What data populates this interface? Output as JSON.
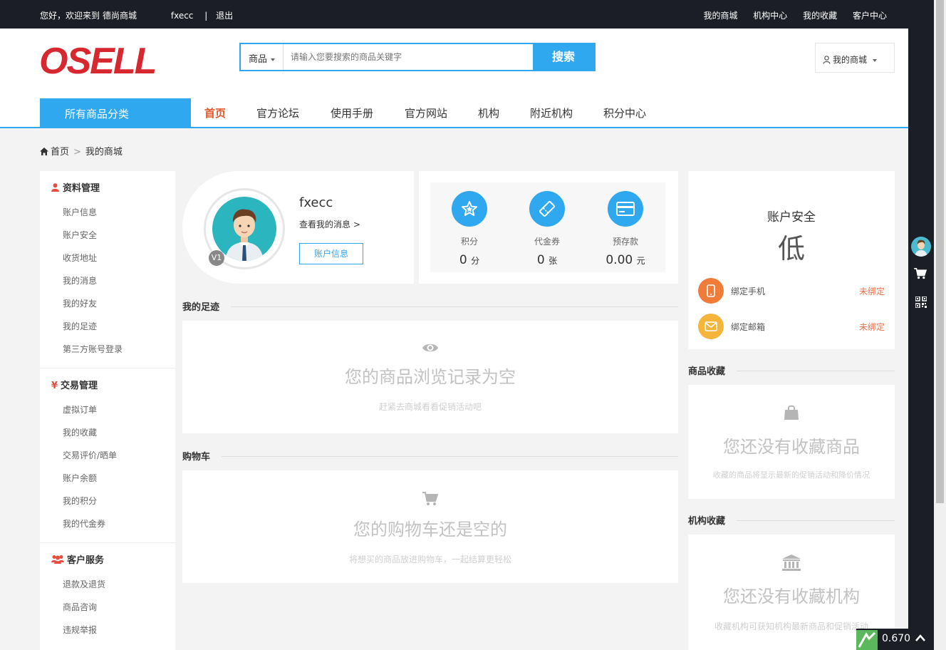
{
  "topbar": {
    "greeting": "您好，欢迎来到",
    "site_name": "德尚商城",
    "username": "fxecc",
    "separator": "|",
    "logout": "退出",
    "links": [
      "我的商城",
      "机构中心",
      "我的收藏",
      "客户中心"
    ]
  },
  "header": {
    "logo_text": "OSELL",
    "search": {
      "category": "商品",
      "placeholder": "请输入您要搜索的商品关键字",
      "button": "搜索"
    },
    "my_mall_button": "我的商城"
  },
  "nav": {
    "all_categories": "所有商品分类",
    "items": [
      "首页",
      "官方论坛",
      "使用手册",
      "官方网站",
      "机构",
      "附近机构",
      "积分中心"
    ],
    "active": "首页"
  },
  "breadcrumb": {
    "home": "首页",
    "separator": ">",
    "current": "我的商城"
  },
  "sidebar": {
    "groups": [
      {
        "title": "资料管理",
        "icon": "user-icon",
        "items": [
          "账户信息",
          "账户安全",
          "收货地址",
          "我的消息",
          "我的好友",
          "我的足迹",
          "第三方账号登录"
        ]
      },
      {
        "title": "交易管理",
        "icon": "yen-icon",
        "items": [
          "虚拟订单",
          "我的收藏",
          "交易评价/晒单",
          "账户余额",
          "我的积分",
          "我的代金券"
        ]
      },
      {
        "title": "客户服务",
        "icon": "users-icon",
        "items": [
          "退款及退货",
          "商品咨询",
          "违规举报"
        ]
      }
    ]
  },
  "profile": {
    "name": "fxecc",
    "messages_link": "查看我的消息 >",
    "account_button": "账户信息",
    "level": "V1"
  },
  "assets": {
    "points": {
      "label": "积分",
      "value": "0",
      "unit": "分"
    },
    "vouchers": {
      "label": "代金券",
      "value": "0",
      "unit": "张"
    },
    "deposit": {
      "label": "预存款",
      "value": "0.00",
      "unit": "元"
    }
  },
  "footprint": {
    "title": "我的足迹",
    "empty_title": "您的商品浏览记录为空",
    "empty_sub": "赶紧去商城看看促销活动吧"
  },
  "cart": {
    "title": "购物车",
    "empty_title": "您的购物车还是空的",
    "empty_sub": "将想买的商品放进购物车，一起结算更轻松"
  },
  "security": {
    "title": "账户安全",
    "level": "低",
    "phone": {
      "label": "绑定手机",
      "status": "未绑定"
    },
    "email": {
      "label": "绑定邮箱",
      "status": "未绑定"
    }
  },
  "fav_goods": {
    "title": "商品收藏",
    "empty_title": "您还没有收藏商品",
    "empty_sub": "收藏的商品将显示最新的促销活动和降价情况"
  },
  "fav_store": {
    "title": "机构收藏",
    "empty_title": "您还没有收藏机构",
    "empty_sub": "收藏机构可获知机构最新商品和促销活动"
  },
  "overlay": {
    "value": "0.670"
  },
  "colors": {
    "accent": "#2fa8f0",
    "brand_red": "#d7282f",
    "dark": "#1b1f25",
    "status_warn": "#e8734b",
    "phone_icon_bg": "#f07c3a",
    "email_icon_bg": "#f5b43a"
  }
}
